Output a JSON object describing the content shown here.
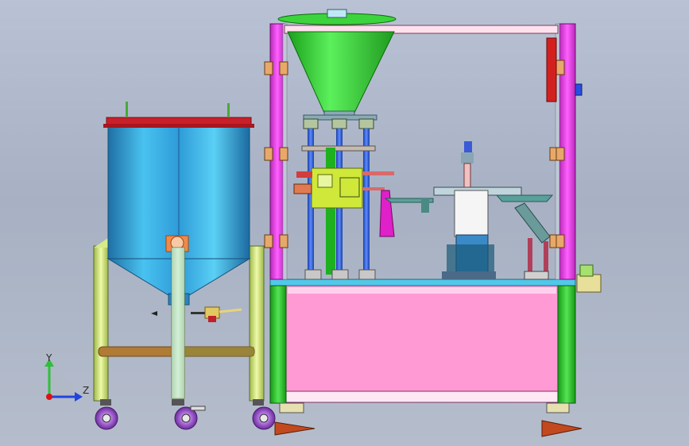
{
  "viewport": {
    "background_top": "#b9c2d4",
    "background_bottom": "#b5bdcc"
  },
  "triad": {
    "y_label": "Y",
    "z_label": "Z",
    "y_color": "#2fbf3a",
    "z_color": "#2244dd",
    "origin_color": "#dd1111"
  },
  "model_colors": {
    "tank": "#3aa6e0",
    "tank_lid": "#c8202a",
    "hopper": "#3cd43c",
    "frame_upright": "#e040e8",
    "frame_green": "#33d633",
    "cabinet_panel": "#ff9ad4",
    "legs": "#d9f08a",
    "casters": "#9a4fc8"
  }
}
